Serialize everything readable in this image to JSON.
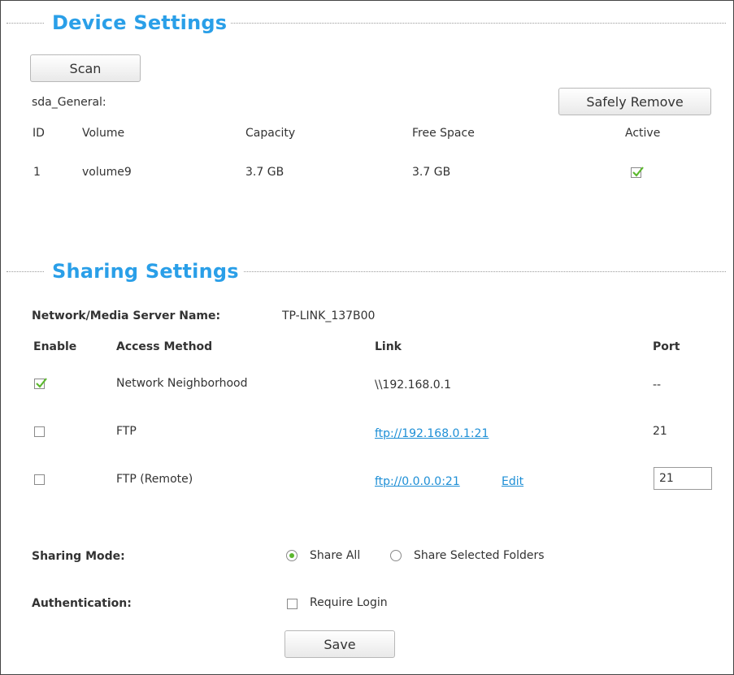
{
  "device": {
    "title": "Device Settings",
    "scan_label": "Scan",
    "disk_name": "sda_General:",
    "safely_remove_label": "Safely Remove",
    "columns": [
      "ID",
      "Volume",
      "Capacity",
      "Free Space",
      "Active"
    ],
    "rows": [
      {
        "id": "1",
        "volume": "volume9",
        "capacity": "3.7 GB",
        "free_space": "3.7 GB",
        "active": true
      }
    ]
  },
  "sharing": {
    "title": "Sharing Settings",
    "server_name_label": "Network/Media Server Name:",
    "server_name_value": "TP-LINK_137B00",
    "columns": [
      "Enable",
      "Access Method",
      "Link",
      "Port"
    ],
    "rows": [
      {
        "enabled": true,
        "method": "Network Neighborhood",
        "link": "\\\\192.168.0.1",
        "port": "--"
      },
      {
        "enabled": false,
        "method": "FTP",
        "link": "ftp://192.168.0.1:21",
        "port": "21"
      },
      {
        "enabled": false,
        "method": "FTP (Remote)",
        "link": "ftp://0.0.0.0:21",
        "edit_label": "Edit",
        "port_value": "21"
      }
    ],
    "mode_label": "Sharing Mode:",
    "mode_options": [
      "Share All",
      "Share Selected Folders"
    ],
    "mode_selected": "Share All",
    "auth_label": "Authentication:",
    "require_login_label": "Require Login",
    "require_login_checked": false,
    "save_label": "Save"
  },
  "colors": {
    "accent": "#2a9fe8",
    "check": "#5cb82e",
    "link": "#1e8fd6"
  }
}
